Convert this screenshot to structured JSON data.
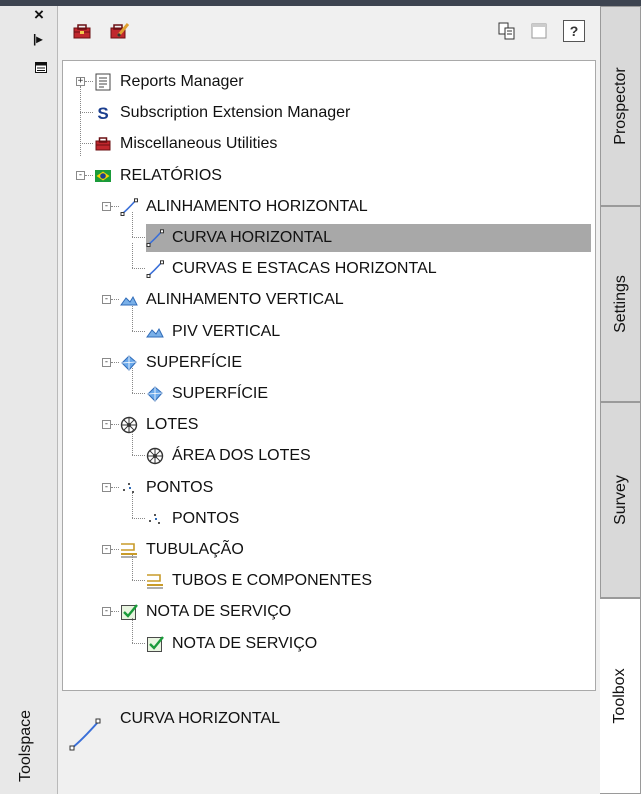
{
  "palette": {
    "title": "Toolspace"
  },
  "toolbar": {
    "icons": [
      "toolbox-icon",
      "edit-toolbox-icon",
      "copy-icon",
      "window-icon",
      "help-icon"
    ],
    "help_label": "?"
  },
  "tree": {
    "items": [
      {
        "label": "Reports Manager",
        "icon": "report-icon"
      },
      {
        "label": "Subscription Extension Manager",
        "icon": "subscription-s-icon",
        "icon_text": "S"
      },
      {
        "label": "Miscellaneous Utilities",
        "icon": "toolbox-icon"
      },
      {
        "label": "RELATÓRIOS",
        "icon": "brazil-flag-icon"
      },
      {
        "label": "ALINHAMENTO HORIZONTAL",
        "icon": "horizontal-curve-icon"
      },
      {
        "label": "CURVA HORIZONTAL",
        "icon": "horizontal-curve-icon",
        "selected": true
      },
      {
        "label": "CURVAS E ESTACAS HORIZONTAL",
        "icon": "horizontal-curve-icon"
      },
      {
        "label": "ALINHAMENTO VERTICAL",
        "icon": "vertical-alignment-icon"
      },
      {
        "label": "PIV VERTICAL",
        "icon": "vertical-alignment-icon"
      },
      {
        "label": "SUPERFÍCIE",
        "icon": "surface-icon"
      },
      {
        "label": "SUPERFÍCIE",
        "icon": "surface-icon"
      },
      {
        "label": "LOTES",
        "icon": "parcel-wheel-icon"
      },
      {
        "label": "ÁREA DOS LOTES",
        "icon": "parcel-wheel-icon"
      },
      {
        "label": "PONTOS",
        "icon": "points-icon"
      },
      {
        "label": "PONTOS",
        "icon": "points-icon"
      },
      {
        "label": "TUBULAÇÃO",
        "icon": "pipe-network-icon"
      },
      {
        "label": "TUBOS E COMPONENTES",
        "icon": "pipe-network-icon"
      },
      {
        "label": "NOTA DE SERVIÇO",
        "icon": "checklist-icon"
      },
      {
        "label": "NOTA DE SERVIÇO",
        "icon": "checklist-icon"
      }
    ]
  },
  "detail": {
    "label": "CURVA HORIZONTAL",
    "icon": "horizontal-curve-icon"
  },
  "tabs": [
    {
      "label": "Prospector"
    },
    {
      "label": "Settings"
    },
    {
      "label": "Survey"
    },
    {
      "label": "Toolbox",
      "active": true
    }
  ],
  "colors": {
    "selection": "#a8a8a8",
    "toolbox_red": "#c0272d",
    "flag_green": "#1a9b3a",
    "curve_blue": "#3a6fd8"
  }
}
